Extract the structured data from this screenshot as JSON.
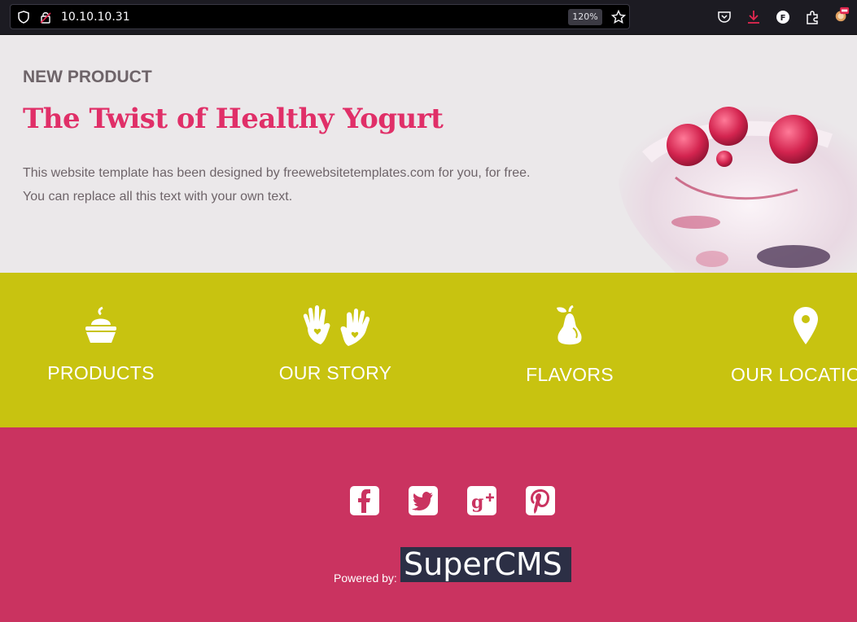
{
  "browser": {
    "url": "10.10.10.31",
    "zoom": "120%",
    "colors": {
      "chrome_bg": "#1c1b22",
      "urlbar_bg": "#000000",
      "download_icon": "#e22850"
    }
  },
  "hero": {
    "eyebrow": "NEW PRODUCT",
    "title": "The Twist of Healthy Yogurt",
    "line1": "This website template has been designed by freewebsitetemplates.com for you, for free.",
    "line2": "You can replace all this text with your own text."
  },
  "nav": {
    "items": [
      {
        "label": "PRODUCTS",
        "icon": "cupcake-icon"
      },
      {
        "label": "OUR STORY",
        "icon": "hands-icon"
      },
      {
        "label": "FLAVORS",
        "icon": "pear-icon"
      },
      {
        "label": "OUR LOCATIO",
        "icon": "location-pin-icon"
      }
    ]
  },
  "footer": {
    "social": [
      "facebook-icon",
      "twitter-icon",
      "google-plus-icon",
      "pinterest-icon"
    ],
    "powered_by": "Powered by:",
    "cms_name": "SuperCMS"
  },
  "colors": {
    "hero_bg": "#ebe8ea",
    "accent_pink": "#e02f68",
    "band_yellow": "#c8c310",
    "footer_pink": "#ca3360",
    "cms_bg": "#2c2f45"
  }
}
